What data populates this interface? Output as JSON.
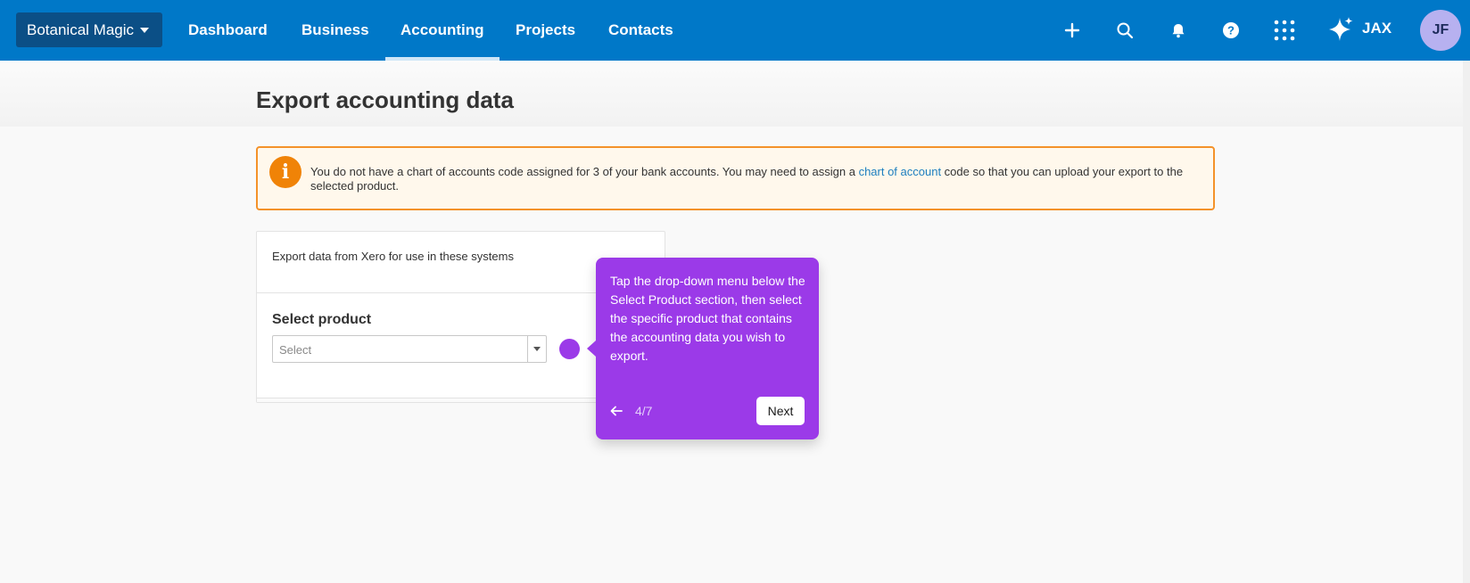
{
  "header": {
    "org_name": "Botanical Magic",
    "nav": [
      {
        "label": "Dashboard"
      },
      {
        "label": "Business"
      },
      {
        "label": "Accounting"
      },
      {
        "label": "Projects"
      },
      {
        "label": "Contacts"
      }
    ],
    "active_nav": "Accounting",
    "assistant_label": "JAX",
    "avatar_initials": "JF",
    "icons": [
      "plus-icon",
      "search-icon",
      "bell-icon",
      "help-icon",
      "apps-grid-icon",
      "sparkle-icon"
    ]
  },
  "page": {
    "title": "Export accounting data"
  },
  "alert": {
    "icon": "info-icon",
    "text_before": "You do not have a chart of accounts code assigned for 3 of your bank accounts. You may need to assign a ",
    "link_text": "chart of account",
    "text_after": " code so that you can upload your export to the selected product."
  },
  "card": {
    "description": "Export data from Xero for use in these systems",
    "select_label": "Select product",
    "select_placeholder": "Select"
  },
  "tooltip": {
    "text": "Tap the drop-down menu below the Select Product section, then select the specific product that contains the accounting data you wish to export.",
    "step": "4/7",
    "next_label": "Next"
  },
  "colors": {
    "topbar": "#0078c8",
    "accent_purple": "#9b3ae8",
    "alert_border": "#f4922a",
    "link": "#1e7fbf"
  }
}
